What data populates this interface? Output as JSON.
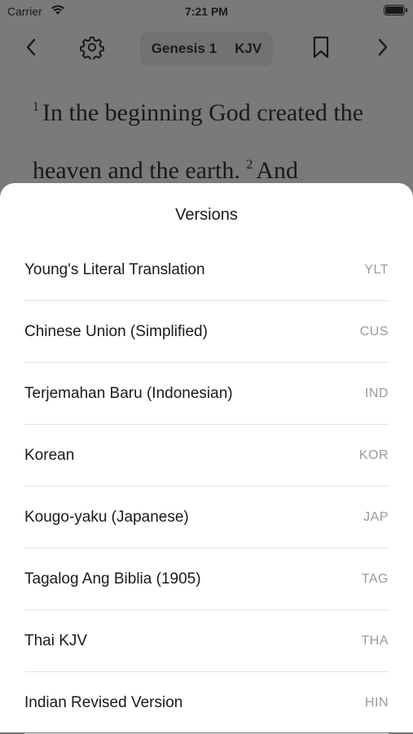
{
  "status_bar": {
    "carrier": "Carrier",
    "time": "7:21 PM"
  },
  "toolbar": {
    "book_chapter": "Genesis 1",
    "version": "KJV",
    "icons": [
      "chevron-left-icon",
      "gear-icon",
      "bookmark-icon",
      "chevron-right-icon"
    ]
  },
  "scripture": {
    "verses": [
      {
        "number": "1",
        "text": "In the beginning God created the heaven and the earth."
      },
      {
        "number": "2",
        "text": "And"
      }
    ]
  },
  "versions_sheet": {
    "title": "Versions",
    "items": [
      {
        "name": "Young's Literal Translation",
        "code": "YLT"
      },
      {
        "name": "Chinese Union (Simplified)",
        "code": "CUS"
      },
      {
        "name": "Terjemahan Baru (Indonesian)",
        "code": "IND"
      },
      {
        "name": "Korean",
        "code": "KOR"
      },
      {
        "name": "Kougo-yaku (Japanese)",
        "code": "JAP"
      },
      {
        "name": "Tagalog Ang Biblia (1905)",
        "code": "TAG"
      },
      {
        "name": "Thai KJV",
        "code": "THA"
      },
      {
        "name": "Indian Revised Version",
        "code": "HIN"
      }
    ]
  },
  "colors": {
    "overlay_background": "#7a7a7a",
    "sheet_background": "#ffffff",
    "code_text": "#9a9a9a"
  }
}
